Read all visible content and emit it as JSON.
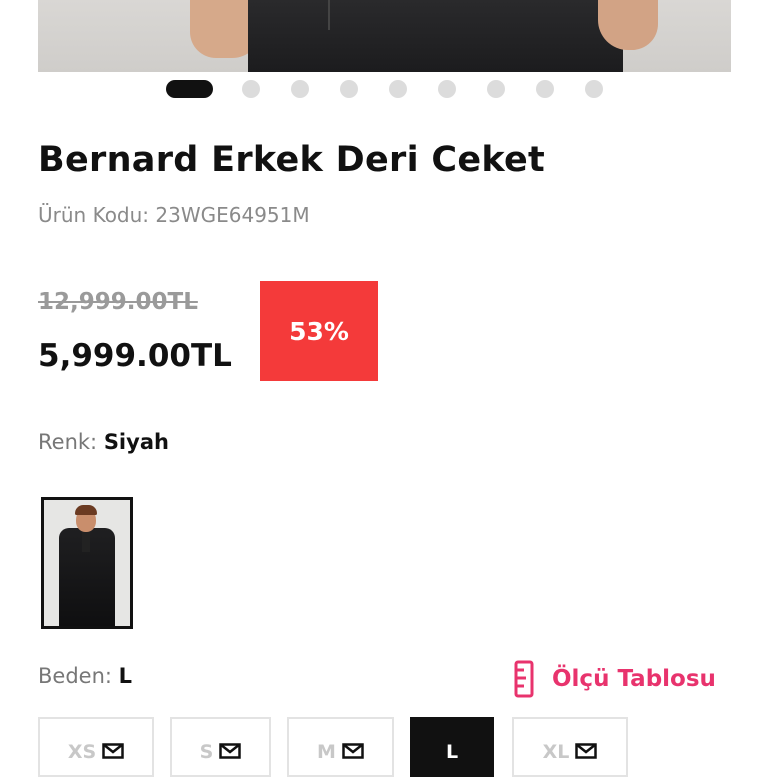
{
  "carousel": {
    "dot_count": 9,
    "active_index": 0
  },
  "product": {
    "title": "Bernard Erkek Deri Ceket",
    "code": "Ürün Kodu: 23WGE64951M",
    "old_price": "12,999.00TL",
    "new_price": "5,999.00TL",
    "discount": "53%"
  },
  "color": {
    "label": "Renk:",
    "value": "Siyah"
  },
  "size": {
    "label": "Beden:",
    "value": "L",
    "chart_label": "Ölçü Tablosu",
    "options": [
      {
        "label": "XS",
        "available": false,
        "selected": false
      },
      {
        "label": "S",
        "available": false,
        "selected": false
      },
      {
        "label": "M",
        "available": false,
        "selected": false
      },
      {
        "label": "L",
        "available": true,
        "selected": true
      },
      {
        "label": "XL",
        "available": false,
        "selected": false
      }
    ]
  },
  "colors": {
    "accent": "#e8336d",
    "discount_badge": "#f43a3a",
    "text": "#111111",
    "muted": "#8a8a8a"
  },
  "icons": {
    "size_chart": "ruler-icon",
    "notify": "mail-icon"
  }
}
